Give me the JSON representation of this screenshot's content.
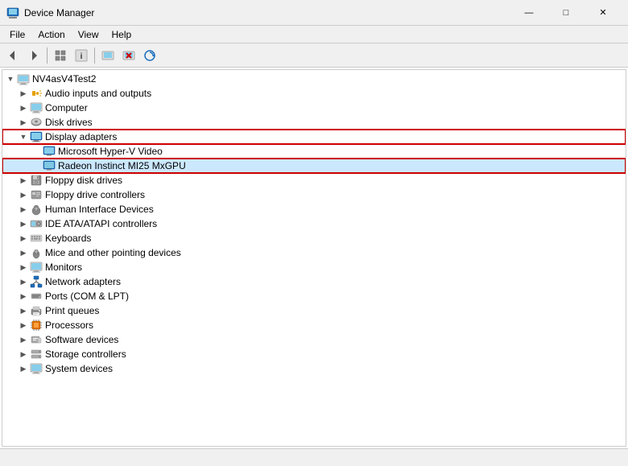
{
  "titleBar": {
    "title": "Device Manager",
    "iconUnicode": "🖥",
    "minBtn": "—",
    "maxBtn": "□",
    "closeBtn": "✕"
  },
  "menuBar": {
    "items": [
      "File",
      "Action",
      "View",
      "Help"
    ]
  },
  "toolbar": {
    "buttons": [
      "◁",
      "▷",
      "📋",
      "📋",
      "❓",
      "🖥",
      "🖥",
      "🗑",
      "⬇"
    ]
  },
  "tree": {
    "rootLabel": "NV4asV4Test2",
    "items": [
      {
        "id": "audio",
        "label": "Audio inputs and outputs",
        "indent": 1,
        "expanded": false,
        "icon": "🔊"
      },
      {
        "id": "computer",
        "label": "Computer",
        "indent": 1,
        "expanded": false,
        "icon": "💻"
      },
      {
        "id": "disk",
        "label": "Disk drives",
        "indent": 1,
        "expanded": false,
        "icon": "💾"
      },
      {
        "id": "display",
        "label": "Display adapters",
        "indent": 1,
        "expanded": true,
        "icon": "🖥",
        "highlight": true
      },
      {
        "id": "hyperv",
        "label": "Microsoft Hyper-V Video",
        "indent": 2,
        "expanded": false,
        "icon": "🖥",
        "leaf": true
      },
      {
        "id": "radeon",
        "label": "Radeon Instinct MI25 MxGPU",
        "indent": 2,
        "expanded": false,
        "icon": "🖥",
        "leaf": true,
        "selected": true
      },
      {
        "id": "floppy-disk",
        "label": "Floppy disk drives",
        "indent": 1,
        "expanded": false,
        "icon": "💾"
      },
      {
        "id": "floppy-ctrl",
        "label": "Floppy drive controllers",
        "indent": 1,
        "expanded": false,
        "icon": "💾"
      },
      {
        "id": "hid",
        "label": "Human Interface Devices",
        "indent": 1,
        "expanded": false,
        "icon": "🖱"
      },
      {
        "id": "ide",
        "label": "IDE ATA/ATAPI controllers",
        "indent": 1,
        "expanded": false,
        "icon": "💿"
      },
      {
        "id": "keyboards",
        "label": "Keyboards",
        "indent": 1,
        "expanded": false,
        "icon": "⌨"
      },
      {
        "id": "mice",
        "label": "Mice and other pointing devices",
        "indent": 1,
        "expanded": false,
        "icon": "🖱"
      },
      {
        "id": "monitors",
        "label": "Monitors",
        "indent": 1,
        "expanded": false,
        "icon": "🖥"
      },
      {
        "id": "network",
        "label": "Network adapters",
        "indent": 1,
        "expanded": false,
        "icon": "🌐"
      },
      {
        "id": "ports",
        "label": "Ports (COM & LPT)",
        "indent": 1,
        "expanded": false,
        "icon": "🔌"
      },
      {
        "id": "print",
        "label": "Print queues",
        "indent": 1,
        "expanded": false,
        "icon": "🖨"
      },
      {
        "id": "proc",
        "label": "Processors",
        "indent": 1,
        "expanded": false,
        "icon": "⚡"
      },
      {
        "id": "soft",
        "label": "Software devices",
        "indent": 1,
        "expanded": false,
        "icon": "💾"
      },
      {
        "id": "storage",
        "label": "Storage controllers",
        "indent": 1,
        "expanded": false,
        "icon": "💾"
      },
      {
        "id": "sys",
        "label": "System devices",
        "indent": 1,
        "expanded": false,
        "icon": "⚙"
      }
    ]
  },
  "statusBar": {
    "text": ""
  }
}
